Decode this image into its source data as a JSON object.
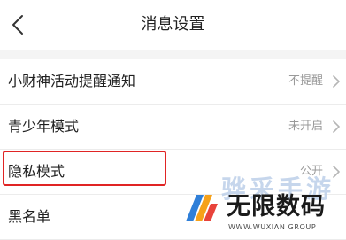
{
  "header": {
    "title": "消息设置",
    "back_icon": "chevron-left-icon"
  },
  "settings": [
    {
      "label": "小财神活动提醒通知",
      "value": "不提醒",
      "chevron": "chevron-right-icon"
    },
    {
      "label": "青少年模式",
      "value": "未开启",
      "chevron": "chevron-right-icon"
    },
    {
      "label": "隐私模式",
      "value": "公开",
      "chevron": "chevron-right-icon"
    },
    {
      "label": "黑名单",
      "value": "",
      "chevron": ""
    }
  ],
  "highlight": {
    "target": "隐私模式",
    "color": "#e02424"
  },
  "watermark": {
    "ghost_text": "骅采手游",
    "title": "无限数码",
    "subtitle": "WWW.WUXIAN GROUP",
    "logo_colors": [
      "#2f7fd8",
      "#f6a11a",
      "#e8433b"
    ]
  },
  "colors": {
    "background": "#ffffff",
    "divider": "#ececec",
    "section_gap": "#f4f4f4",
    "value_text": "#9a9a9a"
  }
}
